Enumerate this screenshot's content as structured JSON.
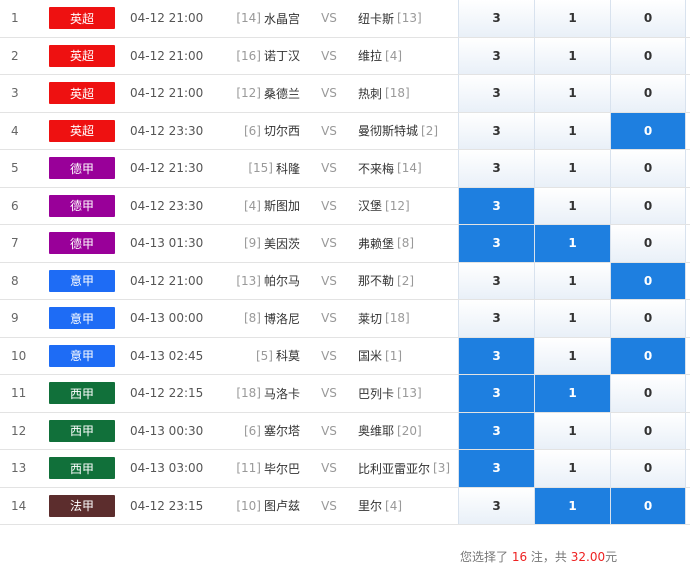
{
  "leagues": {
    "英超": "#ee1111",
    "德甲": "#990099",
    "意甲": "#1e6cf5",
    "西甲": "#11703a",
    "法甲": "#5c2d2d"
  },
  "selected_color": "#1e7fe0",
  "vs_label": "VS",
  "matches": [
    {
      "no": "1",
      "league": "英超",
      "time": "04-12 21:00",
      "home_rank": "[14]",
      "home": "水晶宫",
      "away": "纽卡斯",
      "away_rank": "[13]",
      "odds": [
        "3",
        "1",
        "0"
      ],
      "selected": [
        false,
        false,
        false
      ]
    },
    {
      "no": "2",
      "league": "英超",
      "time": "04-12 21:00",
      "home_rank": "[16]",
      "home": "诺丁汉",
      "away": "维拉",
      "away_rank": "[4]",
      "odds": [
        "3",
        "1",
        "0"
      ],
      "selected": [
        false,
        false,
        false
      ]
    },
    {
      "no": "3",
      "league": "英超",
      "time": "04-12 21:00",
      "home_rank": "[12]",
      "home": "桑德兰",
      "away": "热刺",
      "away_rank": "[18]",
      "odds": [
        "3",
        "1",
        "0"
      ],
      "selected": [
        false,
        false,
        false
      ]
    },
    {
      "no": "4",
      "league": "英超",
      "time": "04-12 23:30",
      "home_rank": "[6]",
      "home": "切尔西",
      "away": "曼彻斯特城",
      "away_rank": "[2]",
      "odds": [
        "3",
        "1",
        "0"
      ],
      "selected": [
        false,
        false,
        true
      ]
    },
    {
      "no": "5",
      "league": "德甲",
      "time": "04-12 21:30",
      "home_rank": "[15]",
      "home": "科隆",
      "away": "不来梅",
      "away_rank": "[14]",
      "odds": [
        "3",
        "1",
        "0"
      ],
      "selected": [
        false,
        false,
        false
      ]
    },
    {
      "no": "6",
      "league": "德甲",
      "time": "04-12 23:30",
      "home_rank": "[4]",
      "home": "斯图加",
      "away": "汉堡",
      "away_rank": "[12]",
      "odds": [
        "3",
        "1",
        "0"
      ],
      "selected": [
        true,
        false,
        false
      ]
    },
    {
      "no": "7",
      "league": "德甲",
      "time": "04-13 01:30",
      "home_rank": "[9]",
      "home": "美因茨",
      "away": "弗赖堡",
      "away_rank": "[8]",
      "odds": [
        "3",
        "1",
        "0"
      ],
      "selected": [
        true,
        true,
        false
      ]
    },
    {
      "no": "8",
      "league": "意甲",
      "time": "04-12 21:00",
      "home_rank": "[13]",
      "home": "帕尔马",
      "away": "那不勒",
      "away_rank": "[2]",
      "odds": [
        "3",
        "1",
        "0"
      ],
      "selected": [
        false,
        false,
        true
      ]
    },
    {
      "no": "9",
      "league": "意甲",
      "time": "04-13 00:00",
      "home_rank": "[8]",
      "home": "博洛尼",
      "away": "莱切",
      "away_rank": "[18]",
      "odds": [
        "3",
        "1",
        "0"
      ],
      "selected": [
        false,
        false,
        false
      ]
    },
    {
      "no": "10",
      "league": "意甲",
      "time": "04-13 02:45",
      "home_rank": "[5]",
      "home": "科莫",
      "away": "国米",
      "away_rank": "[1]",
      "odds": [
        "3",
        "1",
        "0"
      ],
      "selected": [
        true,
        false,
        true
      ]
    },
    {
      "no": "11",
      "league": "西甲",
      "time": "04-12 22:15",
      "home_rank": "[18]",
      "home": "马洛卡",
      "away": "巴列卡",
      "away_rank": "[13]",
      "odds": [
        "3",
        "1",
        "0"
      ],
      "selected": [
        true,
        true,
        false
      ]
    },
    {
      "no": "12",
      "league": "西甲",
      "time": "04-13 00:30",
      "home_rank": "[6]",
      "home": "塞尔塔",
      "away": "奥维耶",
      "away_rank": "[20]",
      "odds": [
        "3",
        "1",
        "0"
      ],
      "selected": [
        true,
        false,
        false
      ]
    },
    {
      "no": "13",
      "league": "西甲",
      "time": "04-13 03:00",
      "home_rank": "[11]",
      "home": "毕尔巴",
      "away": "比利亚雷亚尔",
      "away_rank": "[3]",
      "odds": [
        "3",
        "1",
        "0"
      ],
      "selected": [
        true,
        false,
        false
      ]
    },
    {
      "no": "14",
      "league": "法甲",
      "time": "04-12 23:15",
      "home_rank": "[10]",
      "home": "图卢兹",
      "away": "里尔",
      "away_rank": "[4]",
      "odds": [
        "3",
        "1",
        "0"
      ],
      "selected": [
        false,
        true,
        true
      ]
    }
  ],
  "footer": {
    "prefix": "您选择了 ",
    "count": "16",
    "mid": " 注，共 ",
    "amount": "32.00",
    "suffix": "元"
  }
}
